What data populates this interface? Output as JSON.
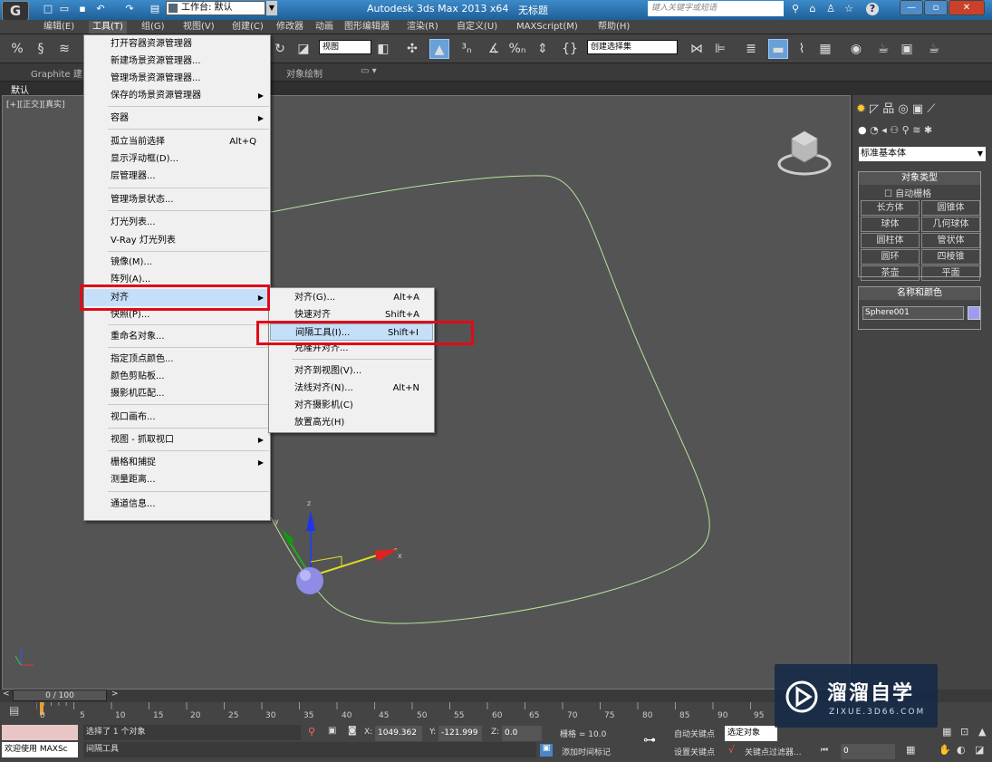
{
  "titlebar": {
    "logo": "G",
    "workspace": "工作台: 默认",
    "app_title": "Autodesk 3ds Max  2013 x64",
    "doc_title": "无标题",
    "search_placeholder": "键入关键字或短语"
  },
  "menubar": {
    "items": [
      "编辑(E)",
      "工具(T)",
      "组(G)",
      "视图(V)",
      "创建(C)",
      "修改器",
      "动画",
      "图形编辑器",
      "渲染(R)",
      "自定义(U)",
      "MAXScript(M)",
      "帮助(H)"
    ],
    "active": "工具(T)"
  },
  "toolbar": {
    "view_select": "视图",
    "selection_set": "创建选择集"
  },
  "ribbon": {
    "tab_graphite": "Graphite 建",
    "tab_object_paint": "对象绘制",
    "default_label": "默认"
  },
  "viewport": {
    "label": "[+][正交][真实]",
    "axis_x": "x",
    "axis_y": "y",
    "axis_z": "z"
  },
  "tools_menu": {
    "items": [
      {
        "label": "打开容器资源管理器"
      },
      {
        "label": "新建场景资源管理器..."
      },
      {
        "label": "管理场景资源管理器..."
      },
      {
        "label": "保存的场景资源管理器",
        "arrow": "▶"
      },
      {
        "label": "容器",
        "arrow": "▶"
      },
      {
        "label": "孤立当前选择",
        "shortcut": "Alt+Q"
      },
      {
        "label": "显示浮动框(D)..."
      },
      {
        "label": "层管理器..."
      },
      {
        "label": "管理场景状态..."
      },
      {
        "label": "灯光列表..."
      },
      {
        "label": "V-Ray 灯光列表"
      },
      {
        "label": "镜像(M)..."
      },
      {
        "label": "阵列(A)..."
      },
      {
        "label": "对齐",
        "arrow": "▶"
      },
      {
        "label": "快照(P)..."
      },
      {
        "label": "重命名对象..."
      },
      {
        "label": "指定顶点颜色..."
      },
      {
        "label": "颜色剪贴板..."
      },
      {
        "label": "摄影机匹配..."
      },
      {
        "label": "视口画布..."
      },
      {
        "label": "视图 - 抓取视口",
        "arrow": "▶"
      },
      {
        "label": "栅格和捕捉",
        "arrow": "▶"
      },
      {
        "label": "测量距离..."
      },
      {
        "label": "通道信息..."
      }
    ]
  },
  "align_submenu": {
    "items": [
      {
        "label": "对齐(G)...",
        "shortcut": "Alt+A"
      },
      {
        "label": "快速对齐",
        "shortcut": "Shift+A"
      },
      {
        "label": "间隔工具(I)...",
        "shortcut": "Shift+I"
      },
      {
        "label": "克隆并对齐..."
      },
      {
        "label": "对齐到视图(V)..."
      },
      {
        "label": "法线对齐(N)...",
        "shortcut": "Alt+N"
      },
      {
        "label": "对齐摄影机(C)"
      },
      {
        "label": "放置高光(H)"
      }
    ]
  },
  "command_panel": {
    "category": "标准基本体",
    "object_type_title": "对象类型",
    "auto_grid": "自动栅格",
    "buttons": [
      "长方体",
      "圆锥体",
      "球体",
      "几何球体",
      "圆柱体",
      "管状体",
      "圆环",
      "四棱锥",
      "茶壶",
      "平面"
    ],
    "name_color_title": "名称和颜色",
    "object_name": "Sphere001",
    "object_color": "#9e9cf0"
  },
  "timeline": {
    "slider": "0 / 100",
    "ticks": [
      "0",
      "5",
      "10",
      "15",
      "20",
      "25",
      "30",
      "35",
      "40",
      "45",
      "50",
      "55",
      "60",
      "65",
      "70",
      "75",
      "80",
      "85",
      "90",
      "95"
    ]
  },
  "status": {
    "welcome": "欢迎使用 MAXSc",
    "selected": "选择了 1 个对象",
    "prompt": "间隔工具",
    "x_label": "X:",
    "x_value": "1049.362",
    "y_label": "Y:",
    "y_value": "-121.999",
    "z_label": "Z:",
    "z_value": "0.0",
    "grid": "栅格 = 10.0",
    "auto_key": "自动关键点",
    "set_key": "设置关键点",
    "selected_obj": "选定对象",
    "key_filters": "关键点过滤器...",
    "add_time_tag": "添加时间标记",
    "frame": "0"
  },
  "watermark": {
    "cn": "溜溜自学",
    "en": "ZIXUE.3D66.COM"
  }
}
